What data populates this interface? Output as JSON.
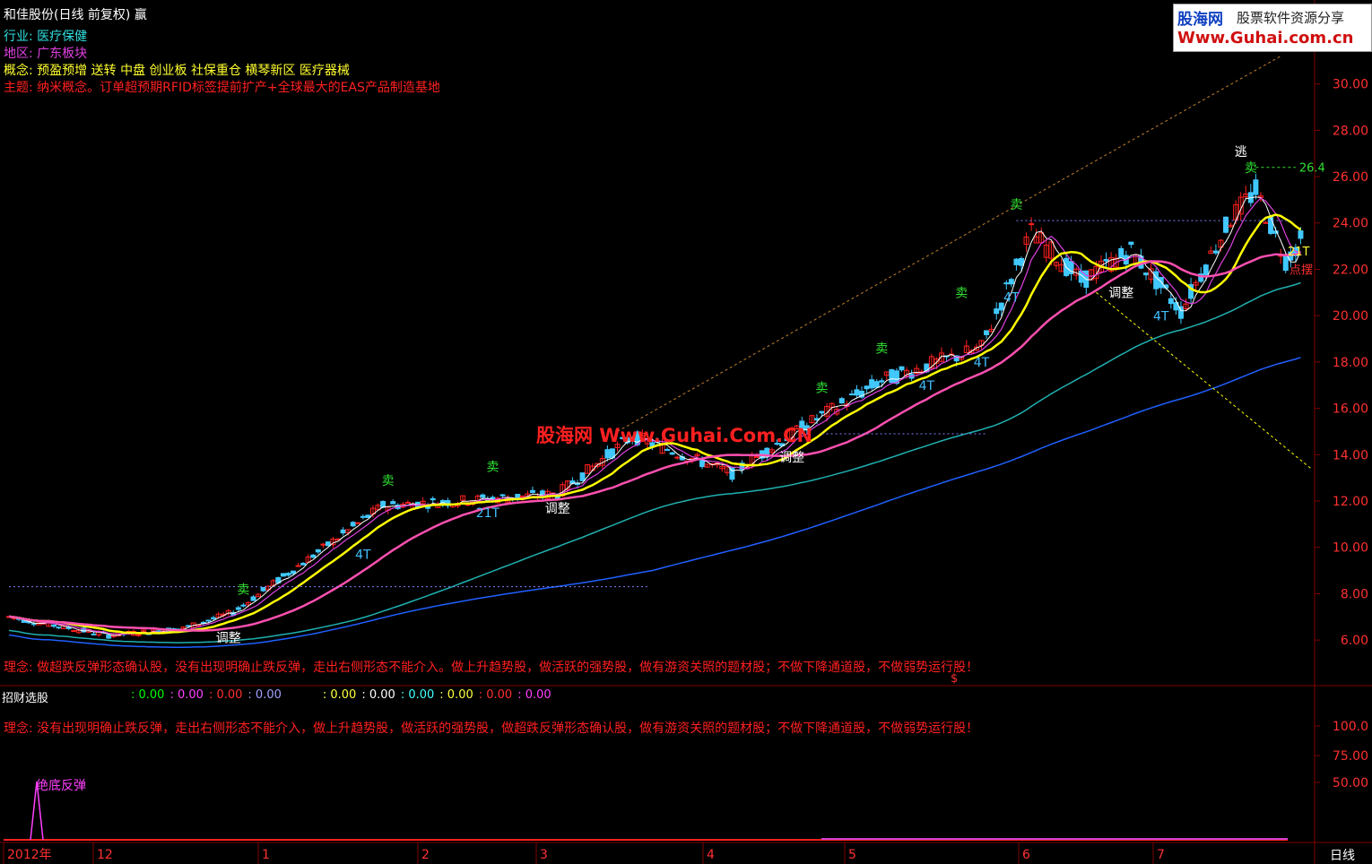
{
  "header": {
    "title": "和佳股份(日线 前复权) 赢",
    "industry_label": "行业:",
    "industry_value": "医疗保健",
    "region_label": "地区:",
    "region_value": "广东板块",
    "concept_label": "概念:",
    "concept_value": "预盈预增 送转 中盘 创业板 社保重仓 横琴新区 医疗器械",
    "theme_label": "主题:",
    "theme_value": "纳米概念。订单超预期RFID标签提前扩产+全球最大的EAS产品制造基地"
  },
  "logo": {
    "brand": "股海网",
    "tagline": "股票软件资源分享",
    "url": "Www.Guhai.com.cn"
  },
  "watermark": "股海网 Www.Guhai.Com.CN",
  "philosophy_main": "理念: 做超跌反弹形态确认股，没有出现明确止跌反弹，走出右侧形态不能介入。做上升趋势股，做活跃的强势股，做有游资关照的题材股；不做下降通道股，不做弱势运行股！",
  "indicator_panel": {
    "name": "招财选股",
    "values": [
      ": 0.00",
      ": 0.00",
      ": 0.00",
      ": 0.00",
      ": 0.00",
      ": 0.00",
      ": 0.00",
      ": 0.00",
      ": 0.00",
      ": 0.00"
    ],
    "value_colors": [
      "#00ff00",
      "#ff40ff",
      "#ff3030",
      "#a0a0ff",
      "#ffff40",
      "#ffffff",
      "#40ffff",
      "#ffff40",
      "#ff3030",
      "#ff40ff"
    ],
    "philosophy": "理念: 没有出现明确止跌反弹，走出右侧形态不能介入，做上升趋势股，做活跃的强势股，做超跌反弹形态确认股，做有游资关照的题材股；不做下降通道股，不做弱势运行股！",
    "signal_label": "绝底反弹",
    "dollar_mark": "$"
  },
  "chart_data": {
    "type": "candlestick",
    "y_ticks": [
      "30.00",
      "28.00",
      "26.00",
      "24.00",
      "22.00",
      "20.00",
      "18.00",
      "16.00",
      "14.00",
      "12.00",
      "10.00",
      "8.00",
      "6.00"
    ],
    "ylim": [
      5.0,
      31.3
    ],
    "indicator_ticks": [
      "100.0",
      "75.00",
      "50.00"
    ],
    "x_labels": [
      "2012年",
      "12",
      "1",
      "2",
      "3",
      "4",
      "5",
      "6",
      "7"
    ],
    "period_label": "日线",
    "max_price_label": "26.4",
    "last_price_label": "21T",
    "price_tag": "点摆",
    "annotations": [
      {
        "text": "卖",
        "x": 47,
        "price": 8.0,
        "color": "#30e030"
      },
      {
        "text": "卖",
        "x": 76,
        "price": 12.7,
        "color": "#30e030"
      },
      {
        "text": "卖",
        "x": 97,
        "price": 13.3,
        "color": "#30e030"
      },
      {
        "text": "卖",
        "x": 163,
        "price": 16.7,
        "color": "#30e030"
      },
      {
        "text": "卖",
        "x": 175,
        "price": 18.4,
        "color": "#30e030"
      },
      {
        "text": "卖",
        "x": 191,
        "price": 20.8,
        "color": "#30e030"
      },
      {
        "text": "卖",
        "x": 202,
        "price": 24.6,
        "color": "#30e030"
      },
      {
        "text": "卖",
        "x": 249,
        "price": 26.2,
        "color": "#30e030"
      },
      {
        "text": "逃",
        "x": 247,
        "price": 26.9,
        "color": "#ffffff"
      },
      {
        "text": "调整",
        "x": 44,
        "price": 5.9,
        "color": "#ffffff"
      },
      {
        "text": "调整",
        "x": 110,
        "price": 11.5,
        "color": "#ffffff"
      },
      {
        "text": "调整",
        "x": 157,
        "price": 13.7,
        "color": "#ffffff"
      },
      {
        "text": "调整",
        "x": 223,
        "price": 20.8,
        "color": "#ffffff"
      },
      {
        "text": "4T",
        "x": 71,
        "price": 9.5,
        "color": "#40c0ff"
      },
      {
        "text": "21T",
        "x": 96,
        "price": 11.3,
        "color": "#40c0ff"
      },
      {
        "text": "4T",
        "x": 184,
        "price": 16.8,
        "color": "#40c0ff"
      },
      {
        "text": "4T",
        "x": 195,
        "price": 17.8,
        "color": "#40c0ff"
      },
      {
        "text": "4T",
        "x": 201,
        "price": 20.6,
        "color": "#40c0ff"
      },
      {
        "text": "4T",
        "x": 231,
        "price": 19.8,
        "color": "#40c0ff"
      }
    ]
  },
  "colors": {
    "up": "#ff2020",
    "down": "#40c8ff",
    "ma_white": "#ffffff",
    "ma_magenta": "#e040e0",
    "ma_yellow": "#ffff00",
    "ma_pink": "#ff50b0",
    "ma_cyan": "#20b0b0",
    "ma_blue": "#2060ff",
    "grid": "#800000"
  }
}
